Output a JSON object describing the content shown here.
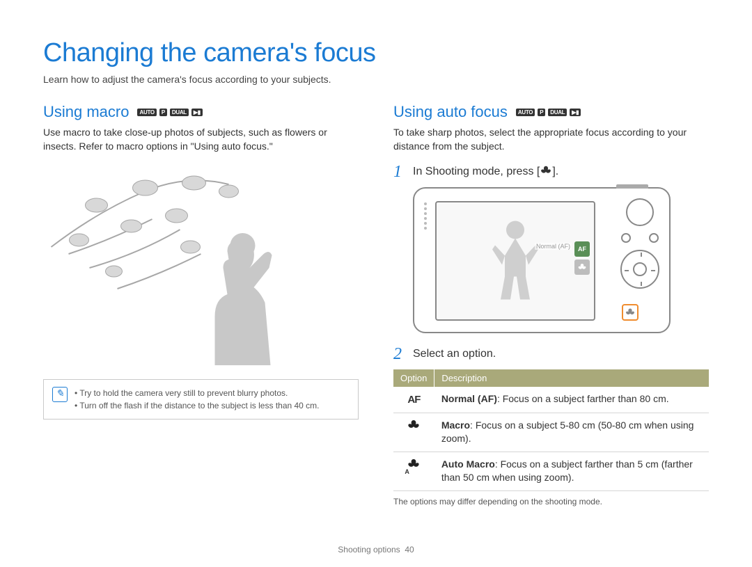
{
  "page": {
    "title": "Changing the camera's focus",
    "subtitle": "Learn how to adjust the camera's focus according to your subjects."
  },
  "modes": [
    "AUTO",
    "P",
    "DUAL",
    "▶▮"
  ],
  "left": {
    "heading": "Using macro",
    "body": "Use macro to take close-up photos of subjects, such as flowers or insects. Refer to macro options in \"Using auto focus.\"",
    "notes": [
      "Try to hold the camera very still to prevent blurry photos.",
      "Turn off the flash if the distance to the subject is less than 40 cm."
    ]
  },
  "right": {
    "heading": "Using auto focus",
    "body": "To take sharp photos, select the appropriate focus according to your distance from the subject.",
    "step1_prefix": "In Shooting mode, press [",
    "step1_suffix": "].",
    "step2": "Select an option.",
    "camera_label": "Normal (AF)",
    "camera_af_text": "AF",
    "table": {
      "head": [
        "Option",
        "Description"
      ],
      "rows": [
        {
          "icon": "AF",
          "bold": "Normal (AF)",
          "rest": ": Focus on a subject farther than 80 cm."
        },
        {
          "icon": "macro",
          "bold": "Macro",
          "rest": ": Focus on a subject 5-80 cm (50-80 cm when using zoom)."
        },
        {
          "icon": "automacro",
          "bold": "Auto Macro",
          "rest": ": Focus on a subject farther than 5 cm (farther than 50 cm when using zoom)."
        }
      ]
    },
    "footnote": "The options may differ depending on the shooting mode."
  },
  "footer": {
    "section": "Shooting options",
    "page": "40"
  }
}
